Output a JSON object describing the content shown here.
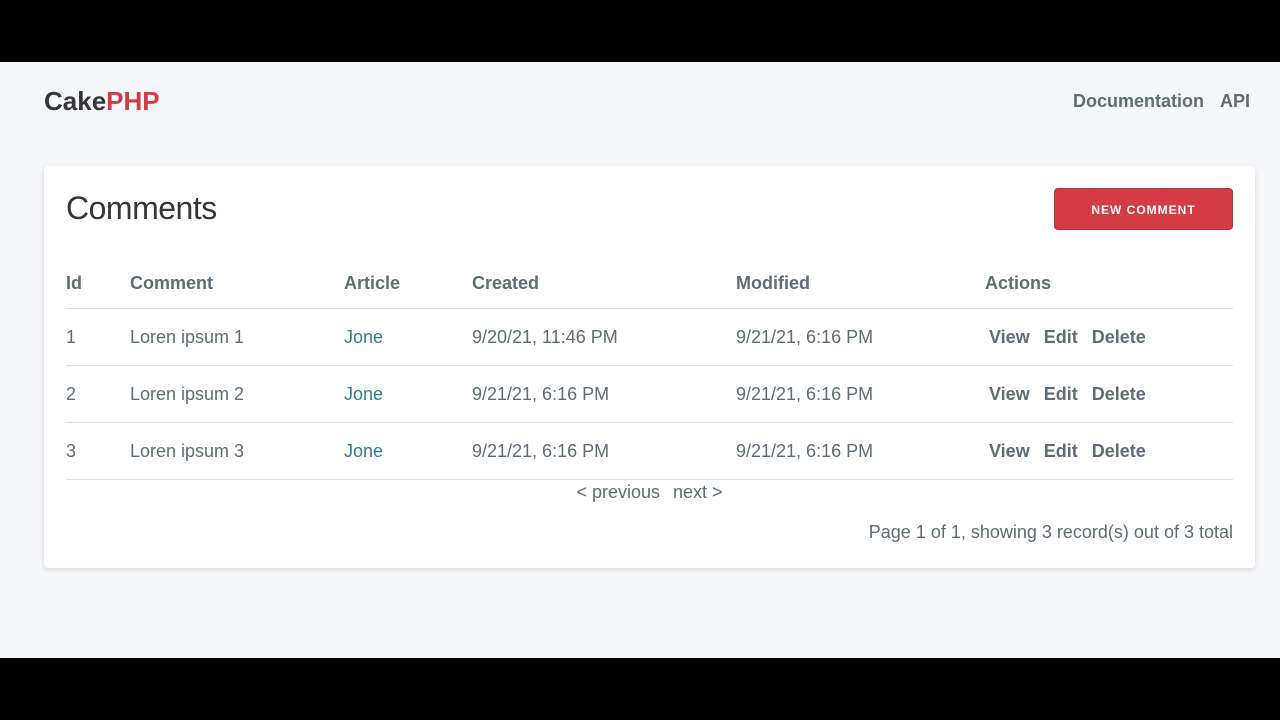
{
  "brand": {
    "part1": "Cake",
    "part2": "PHP"
  },
  "nav": {
    "documentation": "Documentation",
    "api": "API"
  },
  "page": {
    "title": "Comments",
    "new_button": "NEW COMMENT"
  },
  "table": {
    "headers": {
      "id": "Id",
      "comment": "Comment",
      "article": "Article",
      "created": "Created",
      "modified": "Modified",
      "actions": "Actions"
    },
    "rows": [
      {
        "id": "1",
        "comment": "Loren ipsum 1",
        "article": "Jone",
        "created": "9/20/21, 11:46 PM",
        "modified": "9/21/21, 6:16 PM"
      },
      {
        "id": "2",
        "comment": "Loren ipsum 2",
        "article": "Jone",
        "created": "9/21/21, 6:16 PM",
        "modified": "9/21/21, 6:16 PM"
      },
      {
        "id": "3",
        "comment": "Loren ipsum 3",
        "article": "Jone",
        "created": "9/21/21, 6:16 PM",
        "modified": "9/21/21, 6:16 PM"
      }
    ],
    "action_labels": {
      "view": "View",
      "edit": "Edit",
      "delete": "Delete"
    }
  },
  "pagination": {
    "previous": "< previous",
    "next": "next >",
    "info": "Page 1 of 1, showing 3 record(s) out of 3 total"
  },
  "colors": {
    "accent": "#d33c43",
    "link": "#2f7d95",
    "text": "#606c76",
    "background": "#f5f7fa"
  }
}
